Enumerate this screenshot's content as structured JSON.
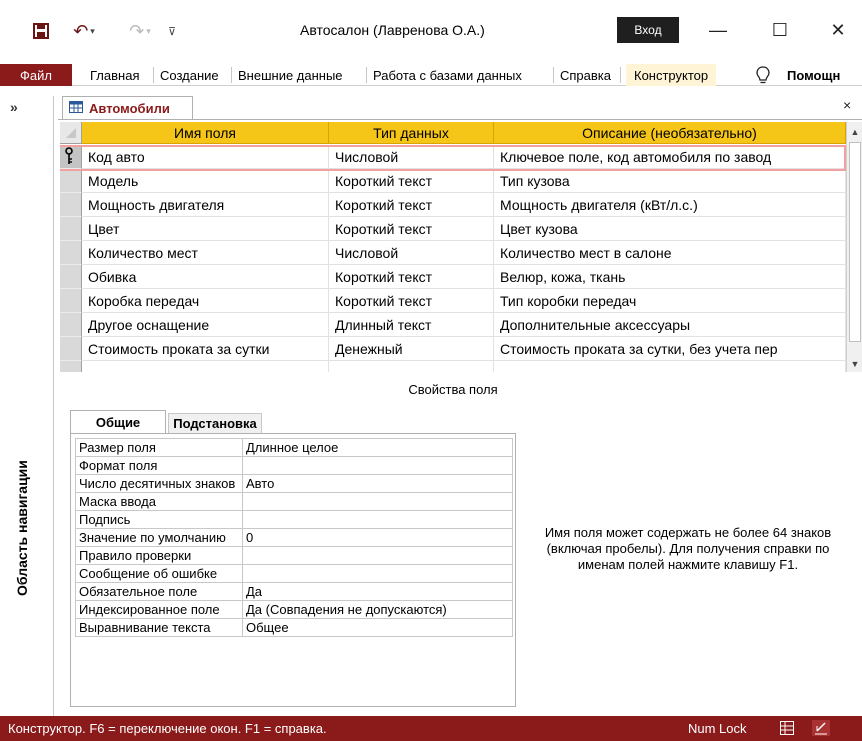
{
  "window": {
    "title": "Автосалон (Лавренова О.А.)",
    "login_label": "Вход",
    "minimize": "—",
    "maximize": "☐",
    "close": "✕",
    "undo_glyph": "↶",
    "redo_glyph": "↷",
    "qat_more": "⊽"
  },
  "ribbon": {
    "file": "Файл",
    "tabs": [
      "Главная",
      "Создание",
      "Внешние данные",
      "Работа с базами данных",
      "Справка",
      "Конструктор"
    ],
    "tell_me_icon": "lightbulb-icon",
    "tell_me": "Помощн"
  },
  "nav": {
    "chevron": "»",
    "label": "Область навигации"
  },
  "document": {
    "tab_title": "Автомобили",
    "close": "×"
  },
  "grid": {
    "headers": [
      "Имя поля",
      "Тип данных",
      "Описание (необязательно)"
    ],
    "rows": [
      {
        "name": "Код авто",
        "type": "Числовой",
        "desc": "Ключевое поле, код автомобиля по завод",
        "key": true
      },
      {
        "name": "Модель",
        "type": "Короткий текст",
        "desc": "Тип кузова"
      },
      {
        "name": "Мощность двигателя",
        "type": "Короткий текст",
        "desc": "Мощность двигателя (кВт/л.с.)"
      },
      {
        "name": "Цвет",
        "type": "Короткий текст",
        "desc": "Цвет кузова"
      },
      {
        "name": "Количество мест",
        "type": "Числовой",
        "desc": "Количество мест в салоне"
      },
      {
        "name": "Обивка",
        "type": "Короткий текст",
        "desc": "Велюр, кожа, ткань"
      },
      {
        "name": "Коробка передач",
        "type": "Короткий текст",
        "desc": "Тип коробки передач"
      },
      {
        "name": "Другое оснащение",
        "type": "Длинный текст",
        "desc": "Дополнительные аксессуары"
      },
      {
        "name": "Стоимость проката за сутки",
        "type": "Денежный",
        "desc": "Стоимость проката за сутки, без учета пер"
      },
      {
        "name": "",
        "type": "",
        "desc": ""
      }
    ]
  },
  "properties": {
    "title": "Свойства поля",
    "tab_general": "Общие",
    "tab_lookup": "Подстановка",
    "rows": [
      {
        "label": "Размер поля",
        "value": "Длинное целое"
      },
      {
        "label": "Формат поля",
        "value": ""
      },
      {
        "label": "Число десятичных знаков",
        "value": "Авто"
      },
      {
        "label": "Маска ввода",
        "value": ""
      },
      {
        "label": "Подпись",
        "value": ""
      },
      {
        "label": "Значение по умолчанию",
        "value": "0"
      },
      {
        "label": "Правило проверки",
        "value": ""
      },
      {
        "label": "Сообщение об ошибке",
        "value": ""
      },
      {
        "label": "Обязательное поле",
        "value": "Да"
      },
      {
        "label": "Индексированное поле",
        "value": "Да (Совпадения не допускаются)"
      },
      {
        "label": "Выравнивание текста",
        "value": "Общее"
      }
    ],
    "help": "Имя поля может содержать не более 64 знаков (включая пробелы). Для получения справки по именам полей нажмите клавишу F1."
  },
  "status": {
    "text": "Конструктор.  F6 = переключение окон.  F1 = справка.",
    "numlock": "Num Lock"
  },
  "colors": {
    "accent": "#8b1a1a",
    "grid_header": "#f5c518",
    "active_row_outline": "#f2a0a0"
  }
}
